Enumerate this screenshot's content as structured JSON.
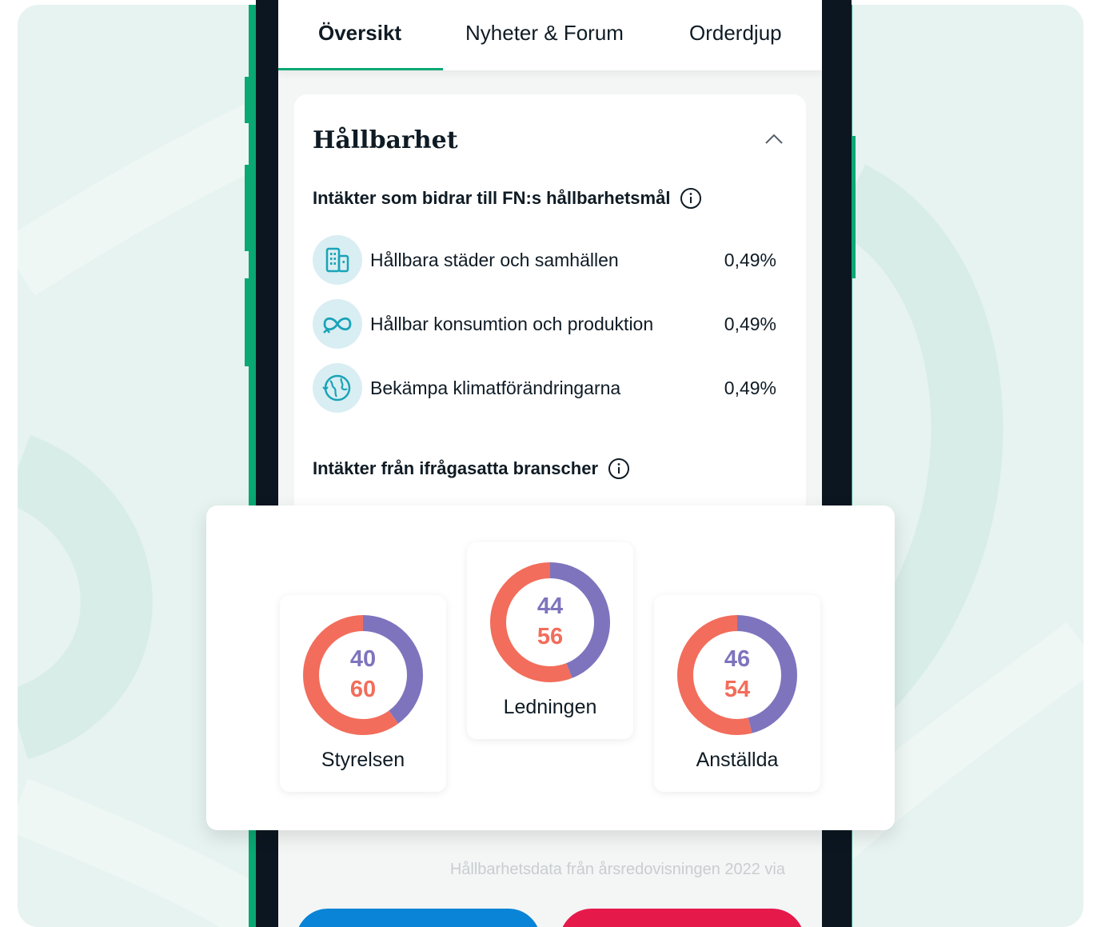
{
  "tabs": [
    {
      "label": "Översikt",
      "active": true
    },
    {
      "label": "Nyheter & Forum",
      "active": false
    },
    {
      "label": "Orderdjup",
      "active": false
    }
  ],
  "sustainability": {
    "title": "Hållbarhet",
    "collapse_icon": "chevron-up-icon",
    "goals_heading": "Intäkter som bidrar till FN:s hållbarhetsmål",
    "goals": [
      {
        "icon": "city-buildings-icon",
        "label": "Hållbara städer och samhällen",
        "value": "0,49%"
      },
      {
        "icon": "infinity-recycle-icon",
        "label": "Hållbar konsumtion och produktion",
        "value": "0,49%"
      },
      {
        "icon": "globe-climate-icon",
        "label": "Bekämpa klimatförändringarna",
        "value": "0,49%"
      }
    ],
    "controversial_heading": "Intäkter från ifrågasatta branscher",
    "footnote": "Hållbarhetsdata från årsredovisningen 2022 via"
  },
  "gender_split": {
    "colors": {
      "first": "#7e74bd",
      "second": "#f26d5b"
    },
    "items": [
      {
        "label": "Styrelsen",
        "first": 40,
        "second": 60
      },
      {
        "label": "Ledningen",
        "first": 44,
        "second": 56
      },
      {
        "label": "Anställda",
        "first": 46,
        "second": 54
      }
    ]
  },
  "colors": {
    "accent": "#0aa873",
    "buy": "#0a84d6",
    "sell": "#e6194b"
  }
}
